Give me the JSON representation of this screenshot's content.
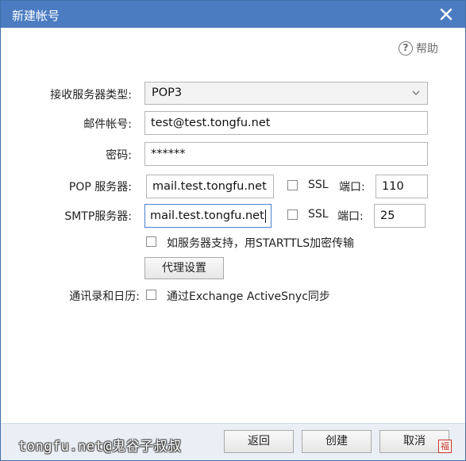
{
  "window": {
    "title": "新建帐号",
    "help_label": "帮助"
  },
  "form": {
    "server_type_label": "接收服务器类型:",
    "server_type_value": "POP3",
    "email_label": "邮件帐号:",
    "email_value": "test@test.tongfu.net",
    "password_label": "密码:",
    "password_value": "******",
    "pop_label": "POP 服务器:",
    "pop_value": "mail.test.tongfu.net",
    "pop_ssl_label": "SSL",
    "pop_port_label": "端口:",
    "pop_port_value": "110",
    "smtp_label": "SMTP服务器:",
    "smtp_value": "mail.test.tongfu.net",
    "smtp_ssl_label": "SSL",
    "smtp_port_label": "端口:",
    "smtp_port_value": "25",
    "starttls_label": "如服务器支持，用STARTTLS加密传输",
    "proxy_button": "代理设置",
    "contacts_label": "通讯录和日历:",
    "activesync_label": "通过Exchange ActiveSnyc同步"
  },
  "footer": {
    "watermark": "tongfu.net@鬼谷子叔叔",
    "back_button": "返回",
    "create_button": "创建",
    "cancel_button": "取消",
    "seal_text": "福"
  },
  "colors": {
    "titlebar": "#4b7cc2",
    "footer": "#eaeff6",
    "focus_border": "#4a7fcc"
  }
}
